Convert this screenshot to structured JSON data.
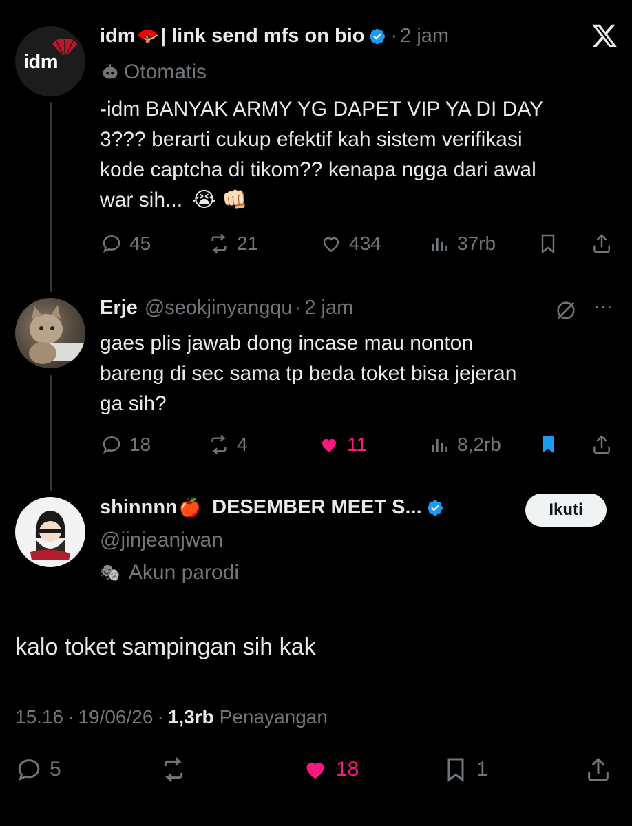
{
  "tweet1": {
    "author_name": "idm",
    "emoji": "🪭",
    "name_suffix": "| link send mfs on bio",
    "dot": "·",
    "time": "2 jam",
    "label": "Otomatis",
    "avatar_text": "idm",
    "text_lines": [
      "-idm BANYAK ARMY YG DAPET VIP YA DI DAY",
      "3??? berarti cukup efektif kah sistem verifikasi",
      "kode captcha di tikom?? kenapa ngga dari awal",
      "war sih..."
    ],
    "text_emojis": "😭 👊🏻",
    "replies": "45",
    "retweets": "21",
    "likes": "434",
    "views": "37rb"
  },
  "tweet2": {
    "author_name": "Erje",
    "handle": "@seokjinyangqu",
    "dot": "·",
    "time": "2 jam",
    "text_lines": [
      "gaes plis jawab dong incase mau nonton",
      "bareng di sec sama tp beda toket bisa jejeran",
      "ga sih?"
    ],
    "replies": "18",
    "retweets": "4",
    "likes": "11",
    "views": "8,2rb"
  },
  "tweet3": {
    "author_name": "shinnnn",
    "emoji": "🍎",
    "name_suffix": "DESEMBER MEET S...",
    "handle": "@jinjeanjwan",
    "label": "Akun parodi",
    "label_icon": "🎭",
    "follow_label": "Ikuti",
    "text": "kalo toket sampingan sih kak",
    "time": "15.16",
    "date": "19/06/26",
    "dot": "·",
    "views_count": "1,3rb",
    "views_label": "Penayangan",
    "replies": "5",
    "likes": "18",
    "bookmarks": "1"
  },
  "colors": {
    "background": "#000000",
    "text": "#e7e9ea",
    "muted": "#71767b",
    "like": "#f91880",
    "verified": "#1d9bf0"
  },
  "icons": [
    "x-logo-icon",
    "verified-icon",
    "bot-icon",
    "reply-icon",
    "retweet-icon",
    "like-icon",
    "views-icon",
    "bookmark-icon",
    "share-icon",
    "grok-icon",
    "more-icon",
    "parody-icon"
  ]
}
